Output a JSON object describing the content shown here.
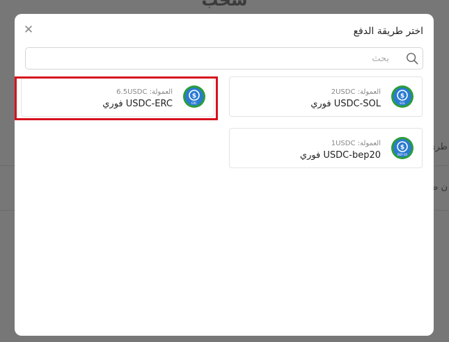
{
  "background": {
    "page_title": "سحب",
    "side_text_1": "طري",
    "side_text_2": "ن طر"
  },
  "modal": {
    "title": "اختر طريقة الدفع",
    "close_icon": "close-icon",
    "search": {
      "placeholder": "بحث",
      "value": "",
      "icon": "search-icon"
    }
  },
  "methods": [
    {
      "id": "usdc-erc",
      "fee_label": "العمولة:",
      "fee": "6.5USDC",
      "name": "USDC-ERC فوري",
      "badge": "ERC",
      "selected": true
    },
    {
      "id": "usdc-sol",
      "fee_label": "العمولة:",
      "fee": "2USDC",
      "name": "USDC-SOL فوري",
      "badge": "SOL",
      "selected": false
    },
    {
      "id": "usdc-bep20",
      "fee_label": "العمولة:",
      "fee": "1USDC",
      "name": "USDC-bep20 فوري",
      "badge": "BEP-20",
      "selected": false
    }
  ],
  "colors": {
    "highlight": "#d6121e",
    "coin_ring": "#2a9d3a",
    "coin_fill": "#2a7bd1"
  }
}
